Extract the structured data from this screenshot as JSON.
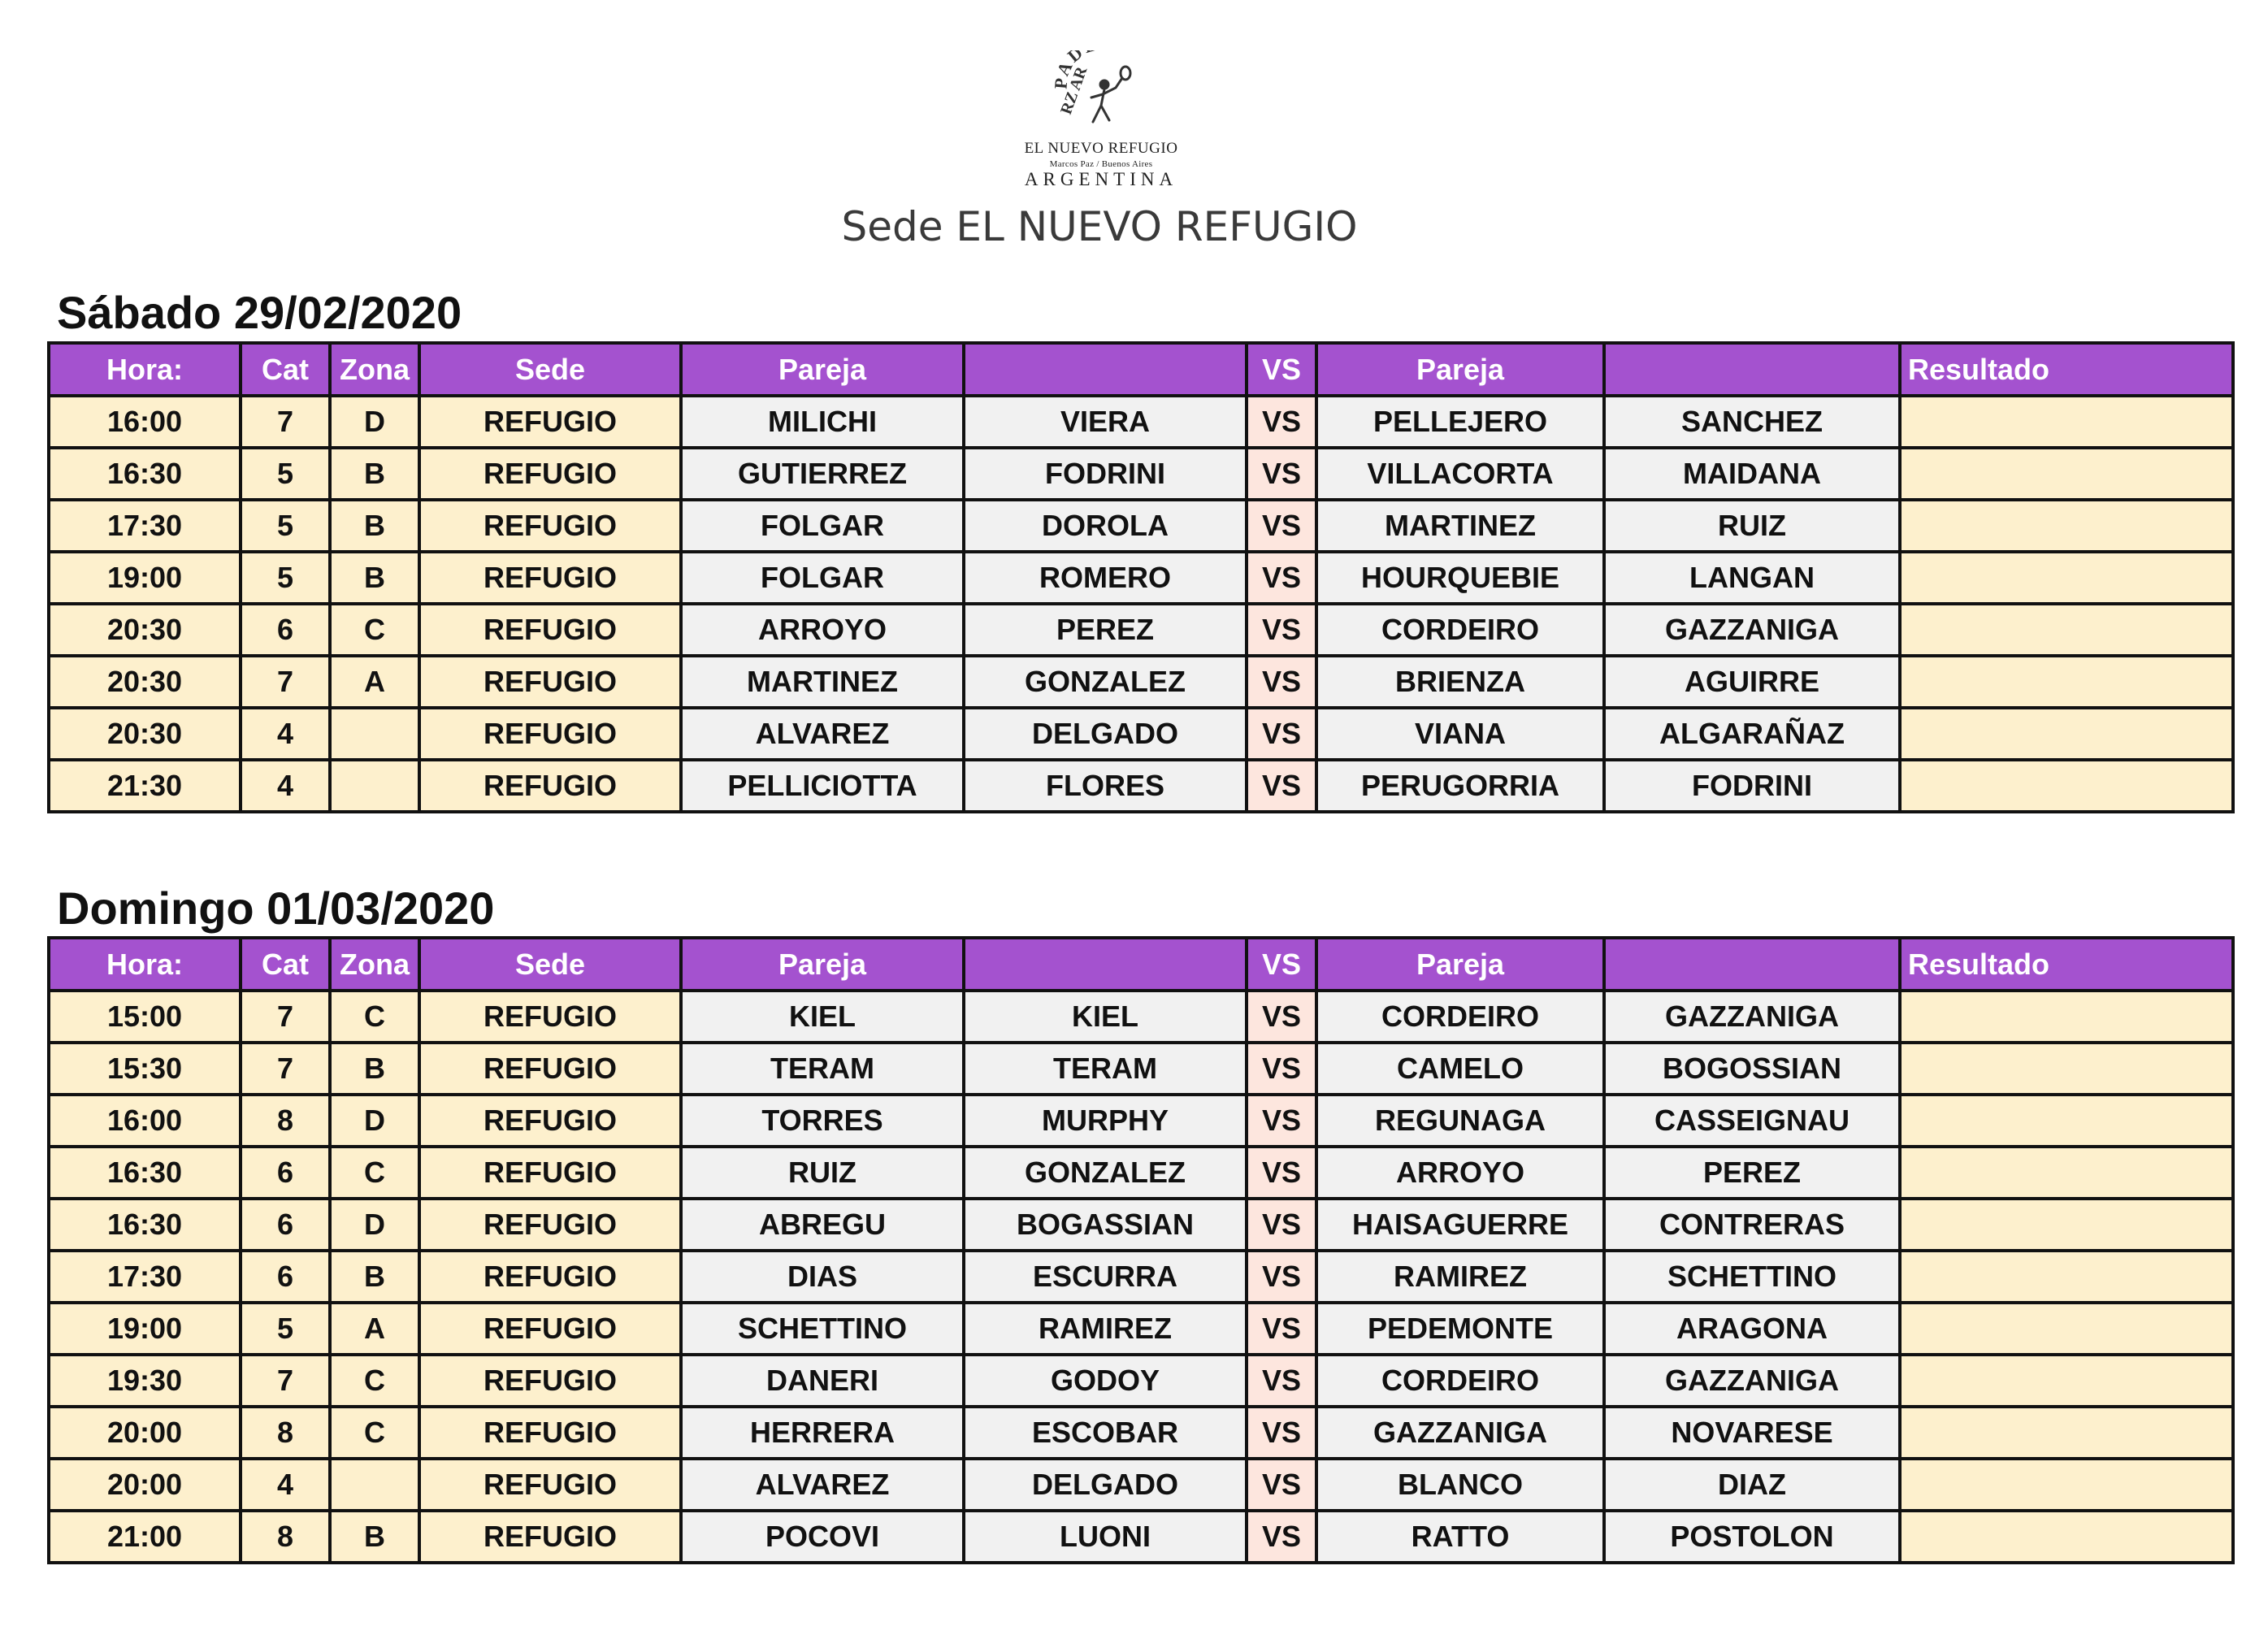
{
  "logo": {
    "brand": "PADEL",
    "mark": "RZ AR",
    "name": "EL NUEVO REFUGIO",
    "location": "Marcos Paz / Buenos Aires",
    "country": "ARGENTINA"
  },
  "page_title": "Sede EL NUEVO REFUGIO",
  "headers": {
    "hora": "Hora:",
    "cat": "Cat",
    "zona": "Zona",
    "sede": "Sede",
    "pareja1": "Pareja",
    "blank1": "",
    "vs": "VS",
    "pareja2": "Pareja",
    "blank2": "",
    "resultado": "Resultado"
  },
  "days": [
    {
      "title": "Sábado 29/02/2020",
      "rows": [
        {
          "hora": "16:00",
          "cat": "7",
          "zona": "D",
          "sede": "REFUGIO",
          "p1a": "MILICHI",
          "p1b": "VIERA",
          "vs": "VS",
          "p2a": "PELLEJERO",
          "p2b": "SANCHEZ",
          "resultado": ""
        },
        {
          "hora": "16:30",
          "cat": "5",
          "zona": "B",
          "sede": "REFUGIO",
          "p1a": "GUTIERREZ",
          "p1b": "FODRINI",
          "vs": "VS",
          "p2a": "VILLACORTA",
          "p2b": "MAIDANA",
          "resultado": ""
        },
        {
          "hora": "17:30",
          "cat": "5",
          "zona": "B",
          "sede": "REFUGIO",
          "p1a": "FOLGAR",
          "p1b": "DOROLA",
          "vs": "VS",
          "p2a": "MARTINEZ",
          "p2b": "RUIZ",
          "resultado": ""
        },
        {
          "hora": "19:00",
          "cat": "5",
          "zona": "B",
          "sede": "REFUGIO",
          "p1a": "FOLGAR",
          "p1b": "ROMERO",
          "vs": "VS",
          "p2a": "HOURQUEBIE",
          "p2b": "LANGAN",
          "resultado": ""
        },
        {
          "hora": "20:30",
          "cat": "6",
          "zona": "C",
          "sede": "REFUGIO",
          "p1a": "ARROYO",
          "p1b": "PEREZ",
          "vs": "VS",
          "p2a": "CORDEIRO",
          "p2b": "GAZZANIGA",
          "resultado": ""
        },
        {
          "hora": "20:30",
          "cat": "7",
          "zona": "A",
          "sede": "REFUGIO",
          "p1a": "MARTINEZ",
          "p1b": "GONZALEZ",
          "vs": "VS",
          "p2a": "BRIENZA",
          "p2b": "AGUIRRE",
          "resultado": ""
        },
        {
          "hora": "20:30",
          "cat": "4",
          "zona": "",
          "sede": "REFUGIO",
          "p1a": "ALVAREZ",
          "p1b": "DELGADO",
          "vs": "VS",
          "p2a": "VIANA",
          "p2b": "ALGARAÑAZ",
          "resultado": ""
        },
        {
          "hora": "21:30",
          "cat": "4",
          "zona": "",
          "sede": "REFUGIO",
          "p1a": "PELLICIOTTA",
          "p1b": "FLORES",
          "vs": "VS",
          "p2a": "PERUGORRIA",
          "p2b": "FODRINI",
          "resultado": ""
        }
      ]
    },
    {
      "title": "Domingo 01/03/2020",
      "rows": [
        {
          "hora": "15:00",
          "cat": "7",
          "zona": "C",
          "sede": "REFUGIO",
          "p1a": "KIEL",
          "p1b": "KIEL",
          "vs": "VS",
          "p2a": "CORDEIRO",
          "p2b": "GAZZANIGA",
          "resultado": ""
        },
        {
          "hora": "15:30",
          "cat": "7",
          "zona": "B",
          "sede": "REFUGIO",
          "p1a": "TERAM",
          "p1b": "TERAM",
          "vs": "VS",
          "p2a": "CAMELO",
          "p2b": "BOGOSSIAN",
          "resultado": ""
        },
        {
          "hora": "16:00",
          "cat": "8",
          "zona": "D",
          "sede": "REFUGIO",
          "p1a": "TORRES",
          "p1b": "MURPHY",
          "vs": "VS",
          "p2a": "REGUNAGA",
          "p2b": "CASSEIGNAU",
          "resultado": ""
        },
        {
          "hora": "16:30",
          "cat": "6",
          "zona": "C",
          "sede": "REFUGIO",
          "p1a": "RUIZ",
          "p1b": "GONZALEZ",
          "vs": "VS",
          "p2a": "ARROYO",
          "p2b": "PEREZ",
          "resultado": ""
        },
        {
          "hora": "16:30",
          "cat": "6",
          "zona": "D",
          "sede": "REFUGIO",
          "p1a": "ABREGU",
          "p1b": "BOGASSIAN",
          "vs": "VS",
          "p2a": "HAISAGUERRE",
          "p2b": "CONTRERAS",
          "resultado": ""
        },
        {
          "hora": "17:30",
          "cat": "6",
          "zona": "B",
          "sede": "REFUGIO",
          "p1a": "DIAS",
          "p1b": "ESCURRA",
          "vs": "VS",
          "p2a": "RAMIREZ",
          "p2b": "SCHETTINO",
          "resultado": ""
        },
        {
          "hora": "19:00",
          "cat": "5",
          "zona": "A",
          "sede": "REFUGIO",
          "p1a": "SCHETTINO",
          "p1b": "RAMIREZ",
          "vs": "VS",
          "p2a": "PEDEMONTE",
          "p2b": "ARAGONA",
          "resultado": ""
        },
        {
          "hora": "19:30",
          "cat": "7",
          "zona": "C",
          "sede": "REFUGIO",
          "p1a": "DANERI",
          "p1b": "GODOY",
          "vs": "VS",
          "p2a": "CORDEIRO",
          "p2b": "GAZZANIGA",
          "resultado": ""
        },
        {
          "hora": "20:00",
          "cat": "8",
          "zona": "C",
          "sede": "REFUGIO",
          "p1a": "HERRERA",
          "p1b": "ESCOBAR",
          "vs": "VS",
          "p2a": "GAZZANIGA",
          "p2b": "NOVARESE",
          "resultado": ""
        },
        {
          "hora": "20:00",
          "cat": "4",
          "zona": "",
          "sede": "REFUGIO",
          "p1a": "ALVAREZ",
          "p1b": "DELGADO",
          "vs": "VS",
          "p2a": "BLANCO",
          "p2b": "DIAZ",
          "resultado": ""
        },
        {
          "hora": "21:00",
          "cat": "8",
          "zona": "B",
          "sede": "REFUGIO",
          "p1a": "POCOVI",
          "p1b": "LUONI",
          "vs": "VS",
          "p2a": "RATTO",
          "p2b": "POSTOLON",
          "resultado": ""
        }
      ]
    }
  ]
}
